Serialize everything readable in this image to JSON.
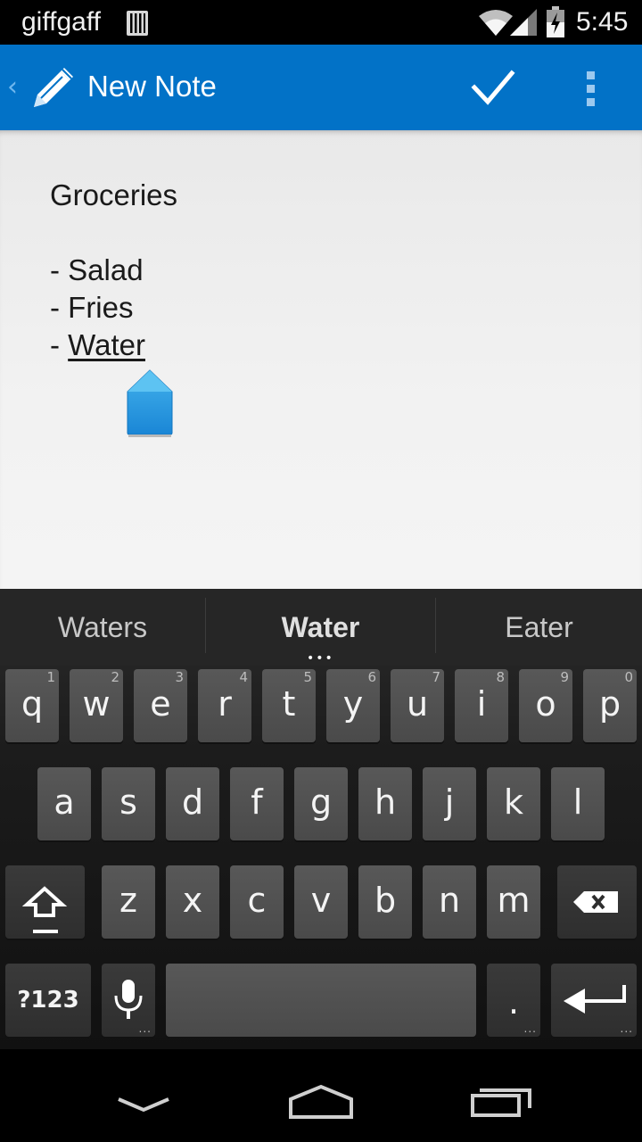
{
  "status_bar": {
    "carrier": "giffgaff",
    "time": "5:45",
    "icons": [
      "sim-icon",
      "wifi-icon",
      "signal-icon",
      "battery-charging-icon"
    ]
  },
  "action_bar": {
    "title": "New Note",
    "back_glyph": "‹",
    "icons": [
      "pencil-icon",
      "checkmark-icon",
      "overflow-menu-icon"
    ],
    "color": "#0272c7"
  },
  "note": {
    "lines": [
      "Groceries",
      "",
      "- Salad",
      "- Fries",
      "- "
    ],
    "composing_word": "Water"
  },
  "keyboard": {
    "suggestions": [
      "Waters",
      "Water",
      "Eater"
    ],
    "suggestion_more": "•••",
    "row1": [
      {
        "key": "q",
        "hint": "1"
      },
      {
        "key": "w",
        "hint": "2"
      },
      {
        "key": "e",
        "hint": "3"
      },
      {
        "key": "r",
        "hint": "4"
      },
      {
        "key": "t",
        "hint": "5"
      },
      {
        "key": "y",
        "hint": "6"
      },
      {
        "key": "u",
        "hint": "7"
      },
      {
        "key": "i",
        "hint": "8"
      },
      {
        "key": "o",
        "hint": "9"
      },
      {
        "key": "p",
        "hint": "0"
      }
    ],
    "row2": [
      "a",
      "s",
      "d",
      "f",
      "g",
      "h",
      "j",
      "k",
      "l"
    ],
    "row3": [
      "z",
      "x",
      "c",
      "v",
      "b",
      "n",
      "m"
    ],
    "symbols_label": "?123",
    "period_label": ".",
    "more_marker": "..."
  },
  "nav_bar": {
    "icons": [
      "back-icon",
      "home-icon",
      "recents-icon"
    ]
  }
}
